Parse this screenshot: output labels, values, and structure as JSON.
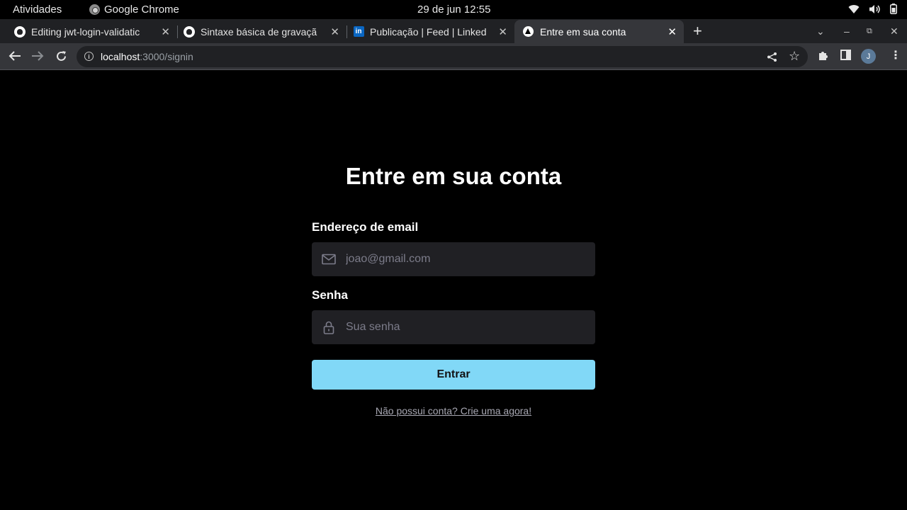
{
  "system_bar": {
    "activities": "Atividades",
    "app_name": "Google Chrome",
    "clock": "29 de jun  12:55"
  },
  "tabs": [
    {
      "title": "Editing jwt-login-validatic",
      "icon": "github-icon"
    },
    {
      "title": "Sintaxe básica de gravaçã",
      "icon": "github-icon"
    },
    {
      "title": "Publicação | Feed | Linked",
      "icon": "linkedin-icon"
    },
    {
      "title": "Entre em sua conta",
      "icon": "nextjs-icon",
      "active": true
    }
  ],
  "address_bar": {
    "host": "localhost",
    "path": ":3000/signin"
  },
  "profile": {
    "initial": "J"
  },
  "form": {
    "heading": "Entre em sua conta",
    "email_label": "Endereço de email",
    "email_placeholder": "joao@gmail.com",
    "password_label": "Senha",
    "password_placeholder": "Sua senha",
    "submit_label": "Entrar",
    "signup_link": "Não possui conta? Crie uma agora!"
  },
  "colors": {
    "background": "#000000",
    "input_background": "#202024",
    "button": "#81d8f7",
    "placeholder": "#7c7c8a"
  }
}
